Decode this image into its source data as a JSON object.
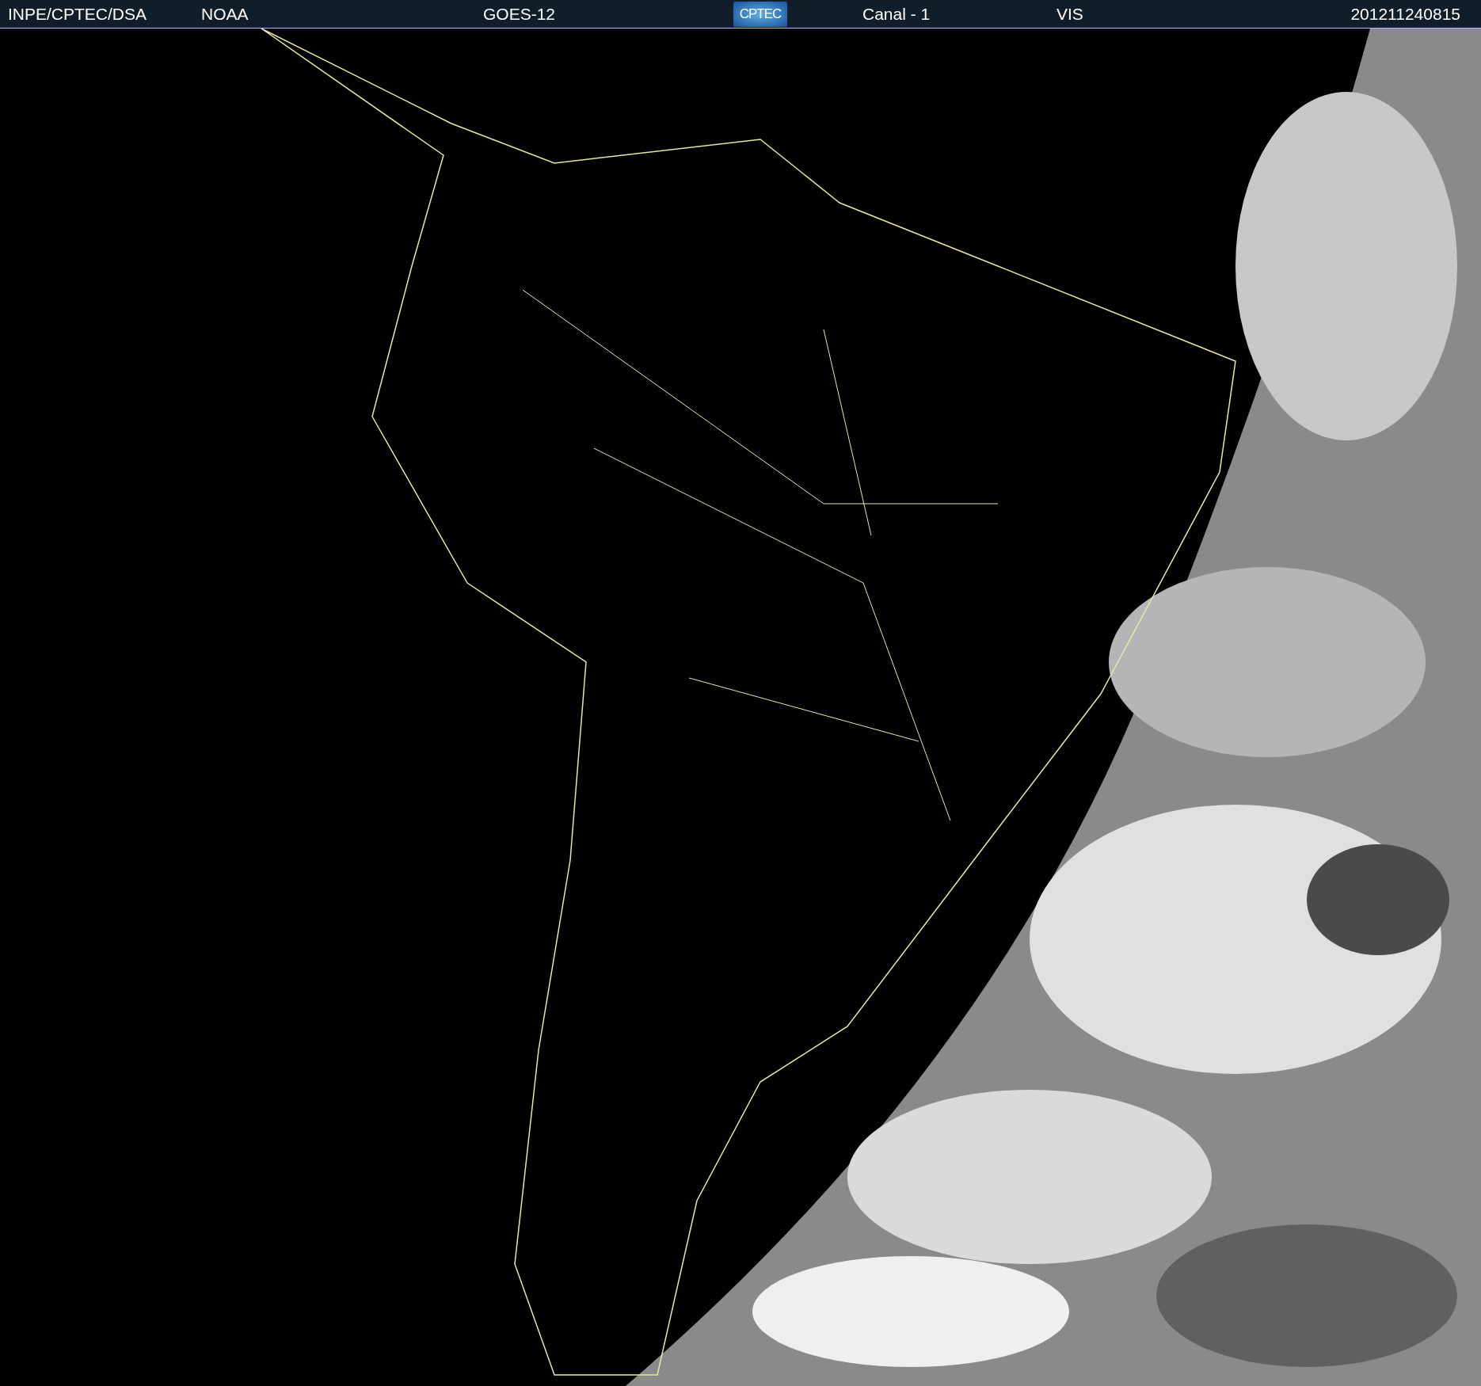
{
  "header": {
    "items": [
      {
        "kind": "text",
        "label": "INPE/CPTEC/DSA"
      },
      {
        "kind": "text",
        "label": "NOAA"
      },
      {
        "kind": "text",
        "label": "GOES-12"
      },
      {
        "kind": "logo",
        "label": "CPTEC"
      },
      {
        "kind": "text",
        "label": "Canal - 1"
      },
      {
        "kind": "text",
        "label": "VIS"
      },
      {
        "kind": "text",
        "label": "201211240815"
      }
    ]
  }
}
